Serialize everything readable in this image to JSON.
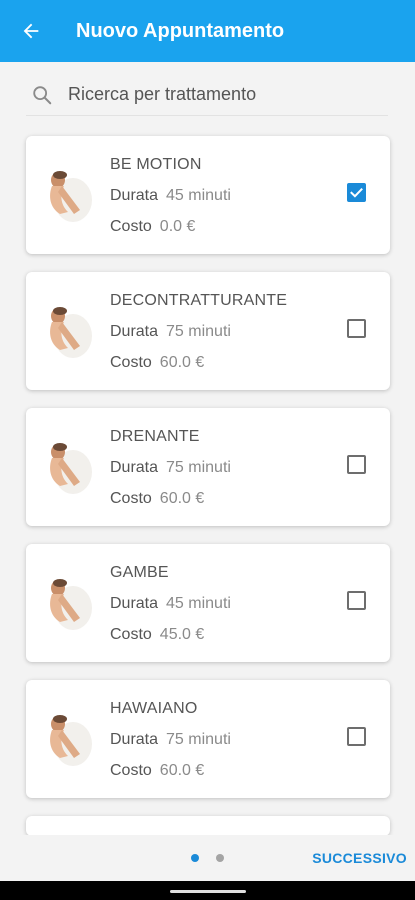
{
  "appbar": {
    "title": "Nuovo Appuntamento"
  },
  "search": {
    "placeholder": "Ricerca per trattamento"
  },
  "labels": {
    "durata": "Durata",
    "costo": "Costo"
  },
  "treatments": [
    {
      "name": "BE MOTION",
      "duration": "45 minuti",
      "cost": "0.0 €",
      "checked": true
    },
    {
      "name": "DECONTRATTURANTE",
      "duration": "75 minuti",
      "cost": "60.0 €",
      "checked": false
    },
    {
      "name": "DRENANTE",
      "duration": "75 minuti",
      "cost": "60.0 €",
      "checked": false
    },
    {
      "name": "GAMBE",
      "duration": "45 minuti",
      "cost": "45.0 €",
      "checked": false
    },
    {
      "name": "HAWAIANO",
      "duration": "75 minuti",
      "cost": "60.0 €",
      "checked": false
    }
  ],
  "pager": {
    "page": 1,
    "total": 2
  },
  "footer": {
    "next_label": "SUCCESSIVO"
  },
  "colors": {
    "primary": "#1aa3ee",
    "accent": "#1a8ad8"
  },
  "icons": [
    "back-arrow-icon",
    "search-icon",
    "massage-thumbnail",
    "checkbox-icon"
  ]
}
